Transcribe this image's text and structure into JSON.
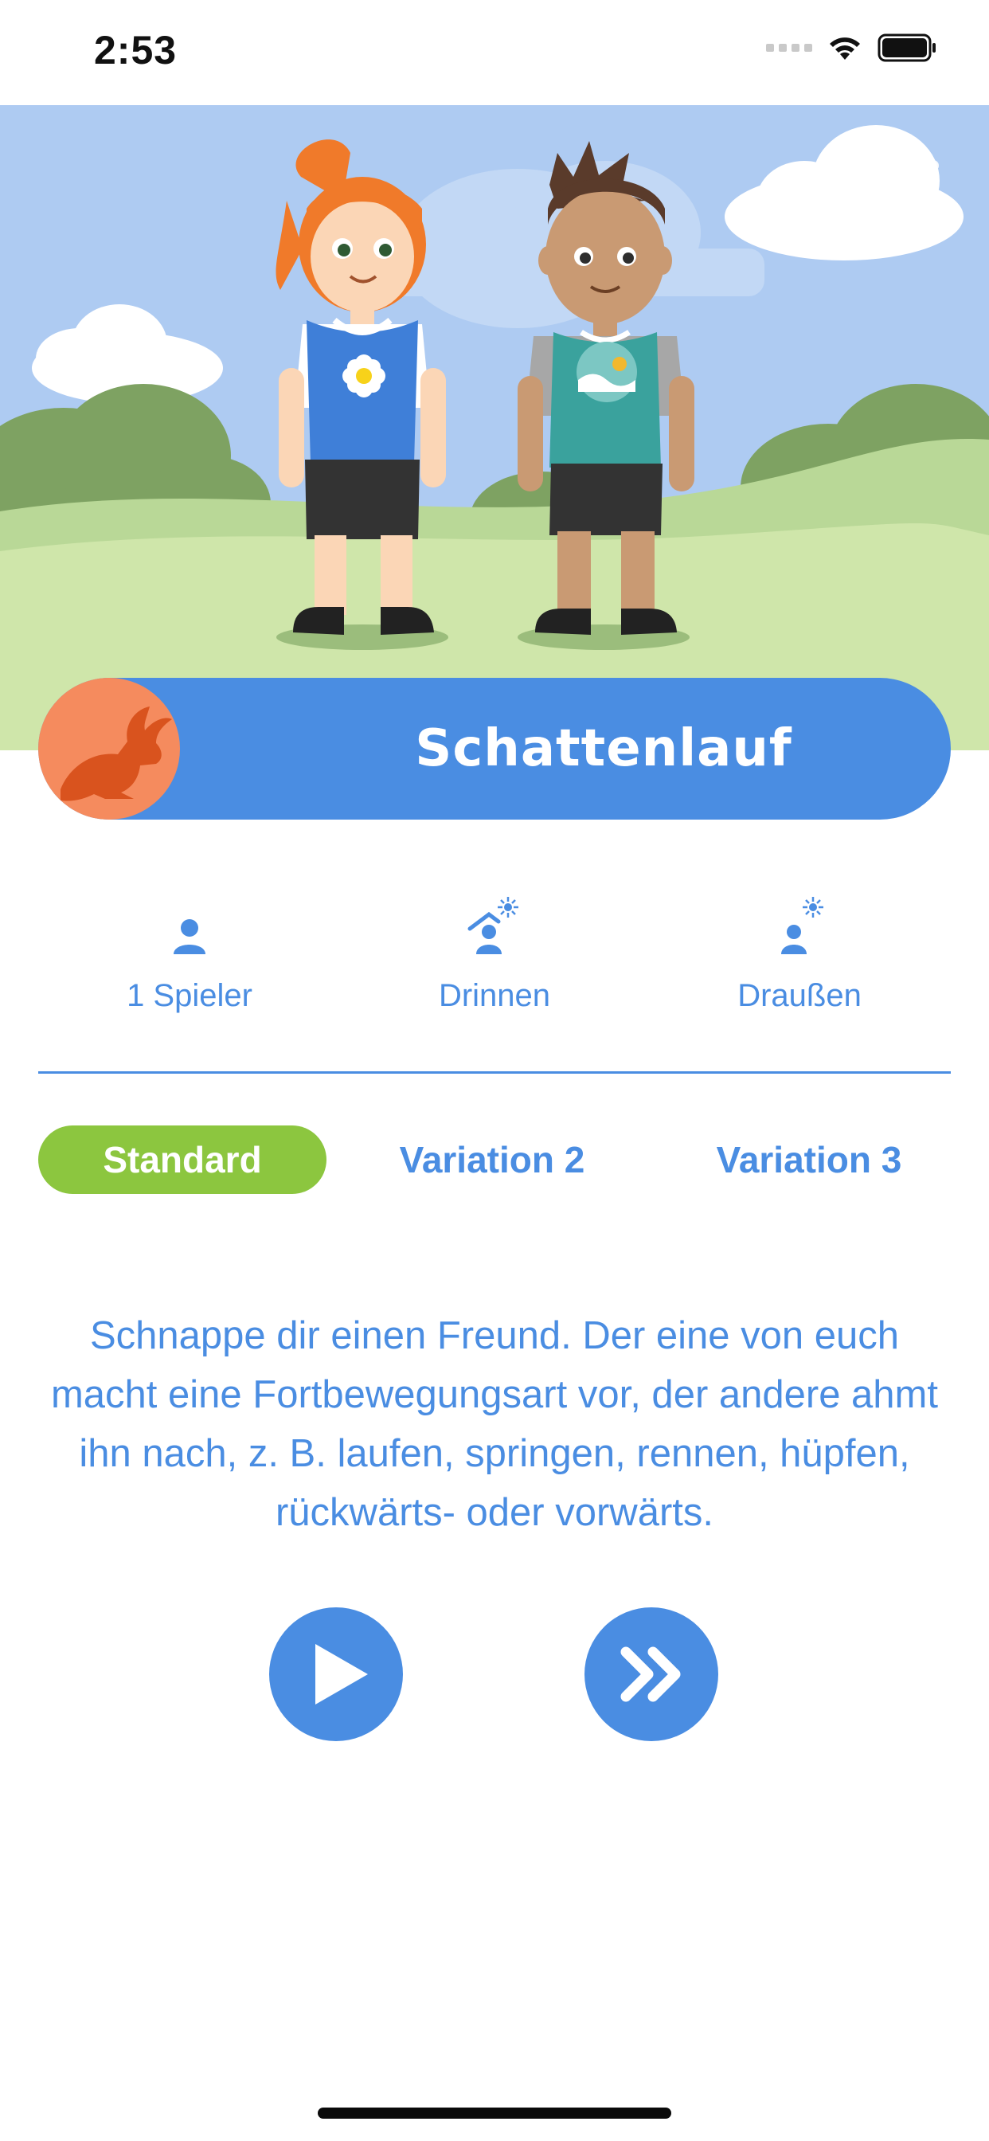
{
  "status_bar": {
    "time": "2:53",
    "icons": [
      "signal-icon",
      "wifi-icon",
      "battery-icon"
    ]
  },
  "hero": {
    "illustration": "two-kids-standing-in-park",
    "close_icon": "close-icon"
  },
  "activity": {
    "title": "Schattenlauf",
    "icon": "rabbit-icon",
    "icon_bg_color": "#f58b5e"
  },
  "info": {
    "players": {
      "icon": "person-icon",
      "label": "1 Spieler"
    },
    "indoor": {
      "icon": "indoor-icon",
      "label": "Drinnen"
    },
    "outdoor": {
      "icon": "outdoor-sun-icon",
      "label": "Draußen"
    }
  },
  "tabs": [
    {
      "label": "Standard",
      "active": true
    },
    {
      "label": "Variation 2",
      "active": false
    },
    {
      "label": "Variation 3",
      "active": false
    }
  ],
  "description": "Schnappe dir einen Freund. Der eine von euch macht eine Fortbewegungsart vor, der andere ahmt ihn nach, z. B. laufen, springen, rennen, hüpfen, rückwärts- oder vorwärts.",
  "controls": {
    "play_icon": "play-icon",
    "next_icon": "fast-forward-icon"
  },
  "colors": {
    "primary_blue": "#4a8de2",
    "active_green": "#8cc63f",
    "accent_orange": "#f58b5e"
  }
}
